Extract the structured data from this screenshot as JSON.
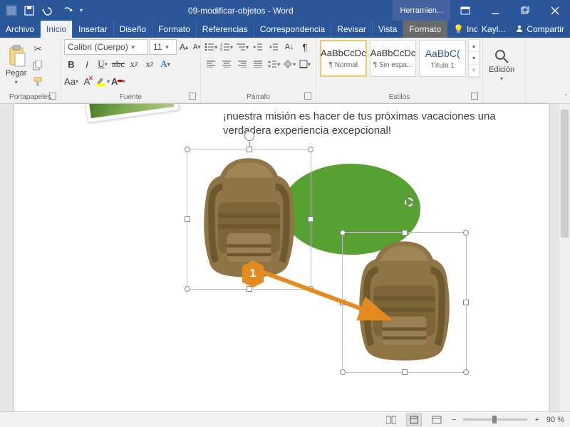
{
  "titlebar": {
    "doc_title": "09-modificar-objetos  -  Word",
    "context_tab": "Herramien..."
  },
  "winbuttons": {
    "ribbon_opts_icon": "ribbon-options-icon"
  },
  "menu": {
    "file": "Archivo",
    "home": "Inicio",
    "insert": "Insertar",
    "design": "Diseño",
    "layout": "Formato",
    "references": "Referencias",
    "mailings": "Correspondencia",
    "review": "Revisar",
    "view": "Vista",
    "format2": "Formato",
    "tell_me": "Indicar...",
    "user": "Kayl...",
    "share": "Compartir"
  },
  "ribbon": {
    "clipboard": {
      "paste": "Pegar",
      "group_label": "Portapapeles"
    },
    "font": {
      "family": "Calibri (Cuerpo)",
      "size": "11",
      "bold": "B",
      "italic": "I",
      "underline": "U",
      "strike": "abc",
      "sub": "x",
      "sup": "x",
      "group_label": "Fuente"
    },
    "paragraph": {
      "group_label": "Párrafo"
    },
    "styles": {
      "sample": "AaBbCcDc",
      "sample_title": "AaBbC(",
      "n1": "¶ Normal",
      "n2": "¶ Sin espa...",
      "n3": "Título 1",
      "group_label": "Estilos"
    },
    "editing": {
      "label": "Edición"
    }
  },
  "document": {
    "paragraph": "¡nuestra misión es hacer de tus próximas vacaciones una verdadera experiencia excepcional!",
    "step_badge": "1"
  },
  "statusbar": {
    "zoom": "90 %",
    "minus": "−",
    "plus": "+"
  }
}
